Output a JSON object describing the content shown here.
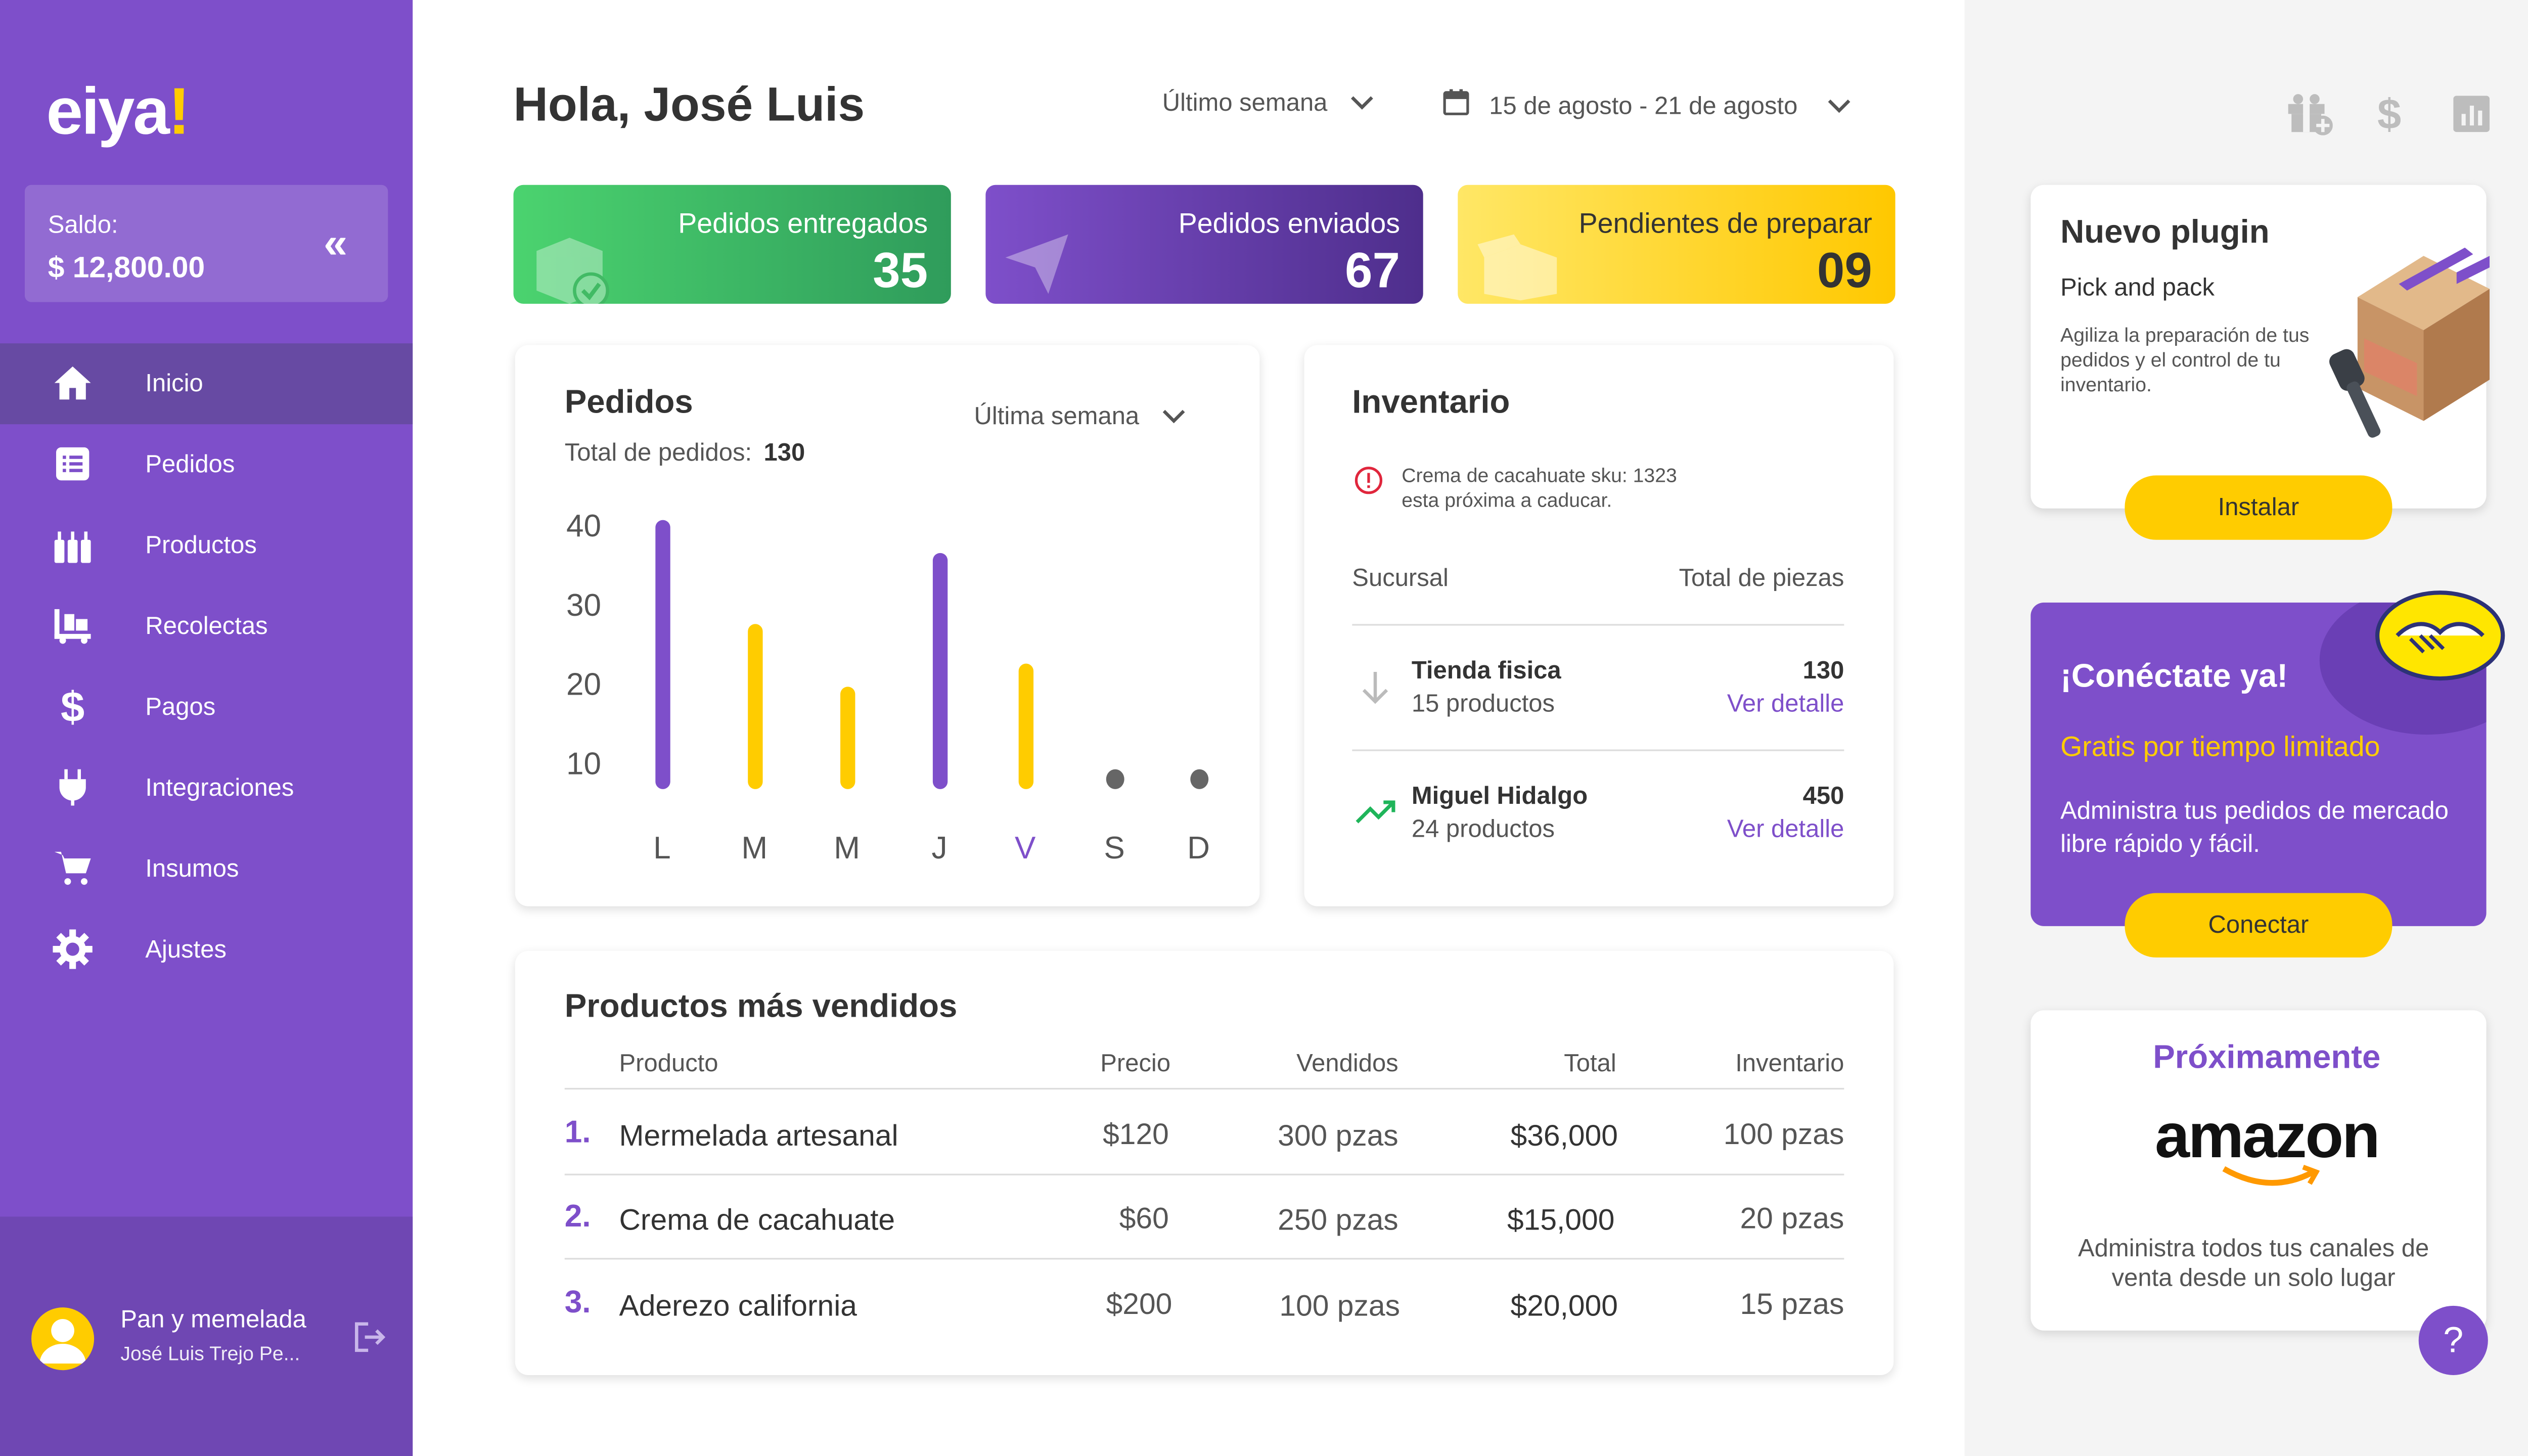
{
  "brand": {
    "name": "eiya",
    "bang": "!"
  },
  "balance": {
    "label": "Saldo:",
    "value": "$ 12,800.00"
  },
  "nav": [
    {
      "label": "Inicio",
      "icon": "home-icon"
    },
    {
      "label": "Pedidos",
      "icon": "list-icon"
    },
    {
      "label": "Productos",
      "icon": "bottles-icon"
    },
    {
      "label": "Recolectas",
      "icon": "cart-dolly-icon"
    },
    {
      "label": "Pagos",
      "icon": "dollar-icon"
    },
    {
      "label": "Integraciones",
      "icon": "plug-icon"
    },
    {
      "label": "Insumos",
      "icon": "shopping-cart-icon"
    },
    {
      "label": "Ajustes",
      "icon": "gear-icon"
    }
  ],
  "user": {
    "store": "Pan y memelada",
    "name": "José Luis Trejo Pe..."
  },
  "header": {
    "greeting": "Hola, José Luis",
    "period": "Último semana",
    "date_range": "15 de agosto - 21 de agosto"
  },
  "stats": [
    {
      "title": "Pedidos entregados",
      "value": "35"
    },
    {
      "title": "Pedidos enviados",
      "value": "67"
    },
    {
      "title": "Pendientes de preparar",
      "value": "09"
    }
  ],
  "orders": {
    "title": "Pedidos",
    "total_label": "Total de pedidos:",
    "total_value": "130",
    "period": "Última semana"
  },
  "chart_data": {
    "type": "bar",
    "categories": [
      "L",
      "M",
      "M",
      "J",
      "V",
      "S",
      "D"
    ],
    "values": [
      41,
      28,
      20,
      37,
      23,
      0,
      0
    ],
    "yticks": [
      "40",
      "30",
      "20",
      "10"
    ],
    "ylim": [
      7,
      41
    ],
    "colors": {
      "purple": "#7e4fca",
      "yellow": "#ffcc00",
      "gray": "#666666"
    },
    "bar_colors": [
      "purple",
      "yellow",
      "yellow",
      "purple",
      "yellow",
      "gray",
      "gray"
    ],
    "highlight_category_index": 4
  },
  "inventory": {
    "title": "Inventario",
    "alert_line1": "Crema de cacahuate sku: 1323",
    "alert_line2": "esta próxima a caducar.",
    "col_branch": "Sucursal",
    "col_total": "Total de piezas",
    "rows": [
      {
        "name": "Tienda fisica",
        "products": "15 productos",
        "total": "130",
        "link": "Ver detalle",
        "icon": "arrow-down-icon"
      },
      {
        "name": "Miguel Hidalgo",
        "products": "24 productos",
        "total": "450",
        "link": "Ver detalle",
        "icon": "trending-up-icon"
      }
    ]
  },
  "top_products": {
    "title": "Productos más vendidos",
    "columns": [
      "Producto",
      "Precio",
      "Vendidos",
      "Total",
      "Inventario"
    ],
    "rows": [
      {
        "rank": "1.",
        "name": "Mermelada artesanal",
        "price": "$120",
        "sold": "300 pzas",
        "total": "$36,000",
        "stock": "100 pzas"
      },
      {
        "rank": "2.",
        "name": "Crema de cacahuate",
        "price": "$60",
        "sold": "250 pzas",
        "total": "$15,000",
        "stock": "20 pzas"
      },
      {
        "rank": "3.",
        "name": "Aderezo california",
        "price": "$200",
        "sold": "100 pzas",
        "total": "$20,000",
        "stock": "15 pzas"
      }
    ]
  },
  "plugin": {
    "title": "Nuevo plugin",
    "subtitle": "Pick and pack",
    "desc": "Agiliza la preparación de tus pedidos y el control de tu inventario.",
    "button": "Instalar"
  },
  "connect": {
    "title": "¡Conéctate ya!",
    "promo": "Gratis por tiempo limitado",
    "desc": "Administra tus pedidos de mercado libre rápido y fácil.",
    "button": "Conectar"
  },
  "soon": {
    "title": "Próximamente",
    "brand": "amazon",
    "desc": "Administra todos tus canales de venta desde un solo lugar",
    "help": "?"
  },
  "colors": {
    "accent": "#7e4fca",
    "yellow": "#ffcc00",
    "green": "#3fbf63",
    "sidebar_active": "#674aa3"
  }
}
